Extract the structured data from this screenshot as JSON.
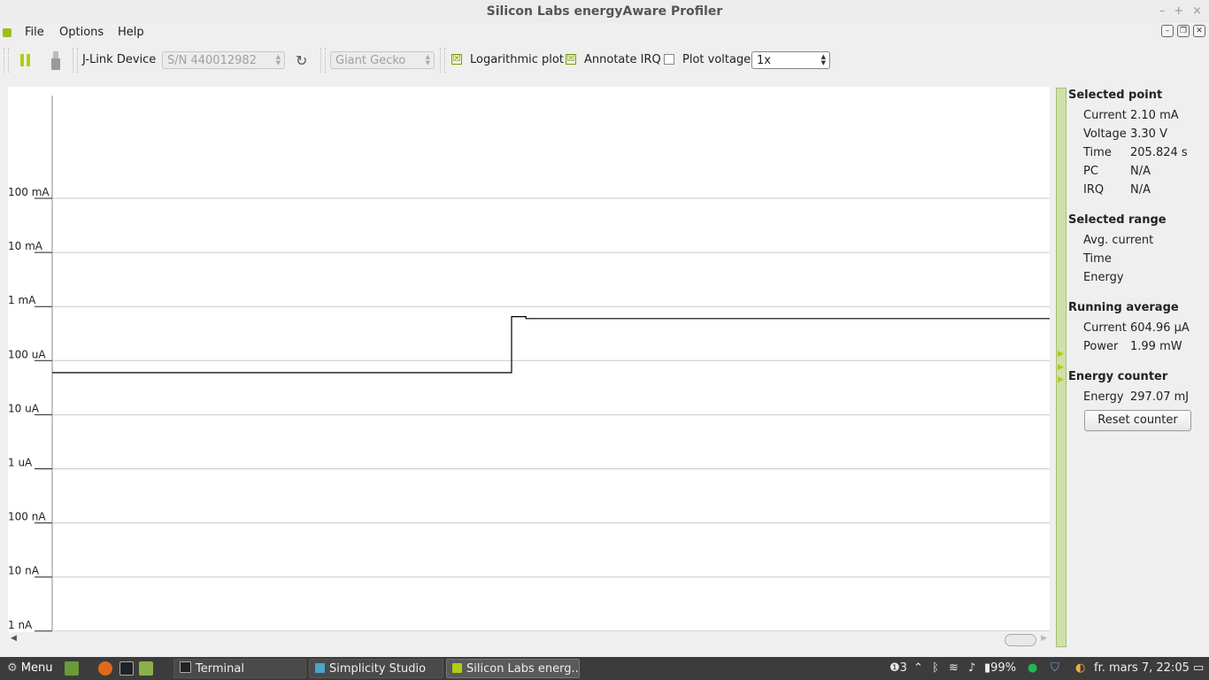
{
  "window": {
    "title": "Silicon Labs energyAware Profiler",
    "controls": [
      "–",
      "+",
      "×"
    ]
  },
  "menu": {
    "items": [
      "File",
      "Options",
      "Help"
    ]
  },
  "toolbar": {
    "jlink_label": "J-Link Device",
    "serial_value": "S/N 440012982",
    "device_value": "Giant Gecko",
    "log_label": "Logarithmic plot",
    "log_checked": true,
    "irq_label": "Annotate IRQ",
    "irq_checked": true,
    "voltage_label": "Plot voltage",
    "voltage_checked": false,
    "zoom_value": "1x"
  },
  "chart_data": {
    "type": "line",
    "yscale": "log",
    "ylabel": "",
    "y_ticks": [
      "100 mA",
      "10 mA",
      "1 mA",
      "100 uA",
      "10 uA",
      "1 uA",
      "100 nA",
      "10 nA",
      "1 nA"
    ],
    "grid": true,
    "series": [
      {
        "x_fraction": [
          0,
          0.46,
          0.4605,
          0.465,
          0.475,
          1
        ],
        "current_A": [
          6e-05,
          6e-05,
          0.00065,
          0.00065,
          0.0006,
          0.0006
        ]
      }
    ]
  },
  "side": {
    "selected_point": {
      "title": "Selected point",
      "rows": [
        {
          "k": "Current",
          "v": "2.10 mA"
        },
        {
          "k": "Voltage",
          "v": "3.30 V"
        },
        {
          "k": "Time",
          "v": "205.824 s"
        },
        {
          "k": "PC",
          "v": "N/A"
        },
        {
          "k": "IRQ",
          "v": "N/A"
        }
      ]
    },
    "selected_range": {
      "title": "Selected range",
      "rows": [
        {
          "k": "Avg. current"
        },
        {
          "k": "Time"
        },
        {
          "k": "Energy"
        }
      ]
    },
    "running_average": {
      "title": "Running average",
      "rows": [
        {
          "k": "Current",
          "v": "604.96 µA"
        },
        {
          "k": "Power",
          "v": "1.99 mW"
        }
      ]
    },
    "energy_counter": {
      "title": "Energy counter",
      "rows": [
        {
          "k": "Energy",
          "v": "297.07 mJ"
        }
      ],
      "reset_label": "Reset counter"
    }
  },
  "taskbar": {
    "menu_label": "Menu",
    "tasks": [
      "Terminal",
      "Simplicity Studio",
      "Silicon Labs energ..."
    ],
    "tray": {
      "notifications": "3",
      "battery": "99%",
      "clock": "fr. mars  7, 22:05"
    }
  }
}
